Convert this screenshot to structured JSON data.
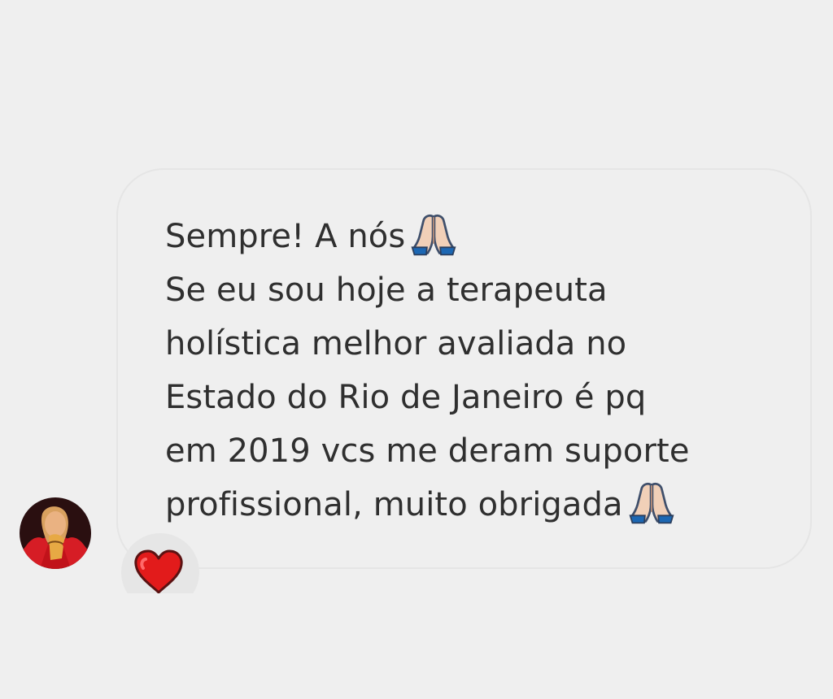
{
  "message": {
    "lines": [
      "Sempre! A nós",
      "Se eu sou hoje a terapeuta",
      "holística melhor avaliada no",
      "Estado do Rio de Janeiro é pq",
      "em 2019 vcs me deram suporte",
      "profissional, muito obrigada"
    ],
    "emoji": {
      "line1_end": "folded-hands-icon",
      "line6_end": "folded-hands-icon"
    }
  },
  "reaction": {
    "icon": "heart-icon",
    "color": "#e21b1b"
  },
  "avatar": {
    "icon": "avatar"
  },
  "colors": {
    "background": "#efefef",
    "bubble_border": "#e5e5e5",
    "text": "#2f2f2f"
  }
}
